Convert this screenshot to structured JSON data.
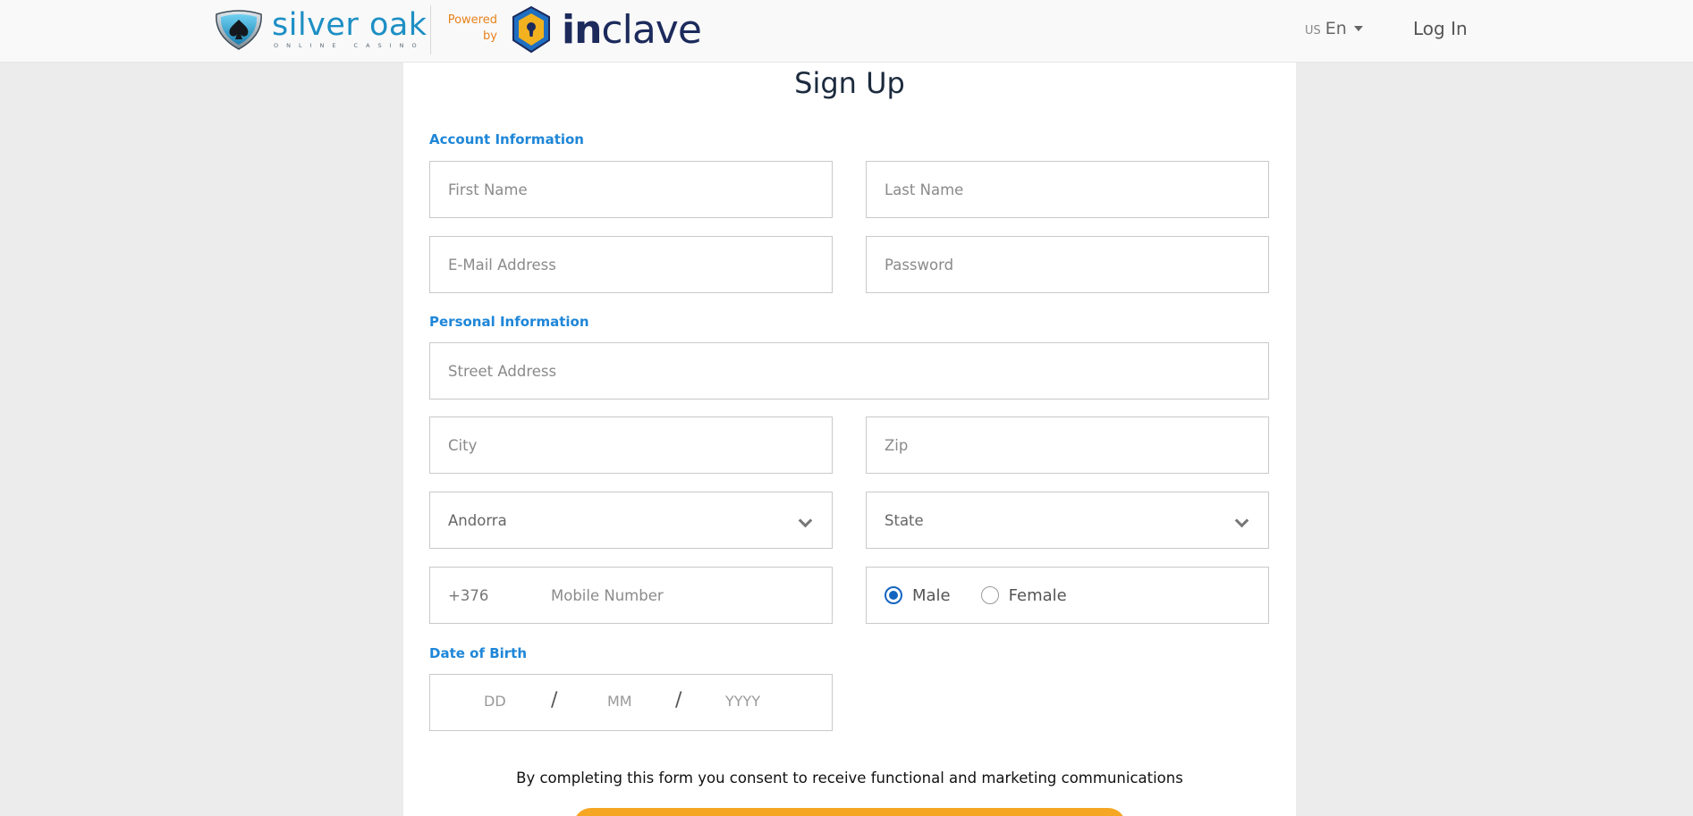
{
  "header": {
    "brand_name": "silver oak",
    "brand_tagline": "ONLINE CASINO",
    "powered_line1": "Powered",
    "powered_line2": "by",
    "partner_bold": "in",
    "partner_rest": "clave",
    "lang_flag": "US",
    "lang_label": "En",
    "login_label": "Log In"
  },
  "form": {
    "title": "Sign Up",
    "account_section": "Account Information",
    "first_name_placeholder": "First Name",
    "last_name_placeholder": "Last Name",
    "email_placeholder": "E-Mail Address",
    "password_placeholder": "Password",
    "personal_section": "Personal Information",
    "street_placeholder": "Street Address",
    "city_placeholder": "City",
    "zip_placeholder": "Zip",
    "country_value": "Andorra",
    "state_value": "State",
    "dial_code": "+376",
    "mobile_placeholder": "Mobile Number",
    "gender_male": "Male",
    "gender_female": "Female",
    "gender_selected": "Male",
    "dob_section": "Date of Birth",
    "dob_day": "DD",
    "dob_month": "MM",
    "dob_year": "YYYY",
    "dob_separator": "/",
    "consent_text": "By completing this form you consent to receive functional and marketing communications"
  },
  "colors": {
    "accent_blue": "#1e86d8",
    "radio_blue": "#1565c0",
    "brand_teal": "#1d8fc4",
    "powered_orange": "#e8821d",
    "inclave_navy": "#1c2a5c",
    "submit_orange": "#f5a623"
  }
}
